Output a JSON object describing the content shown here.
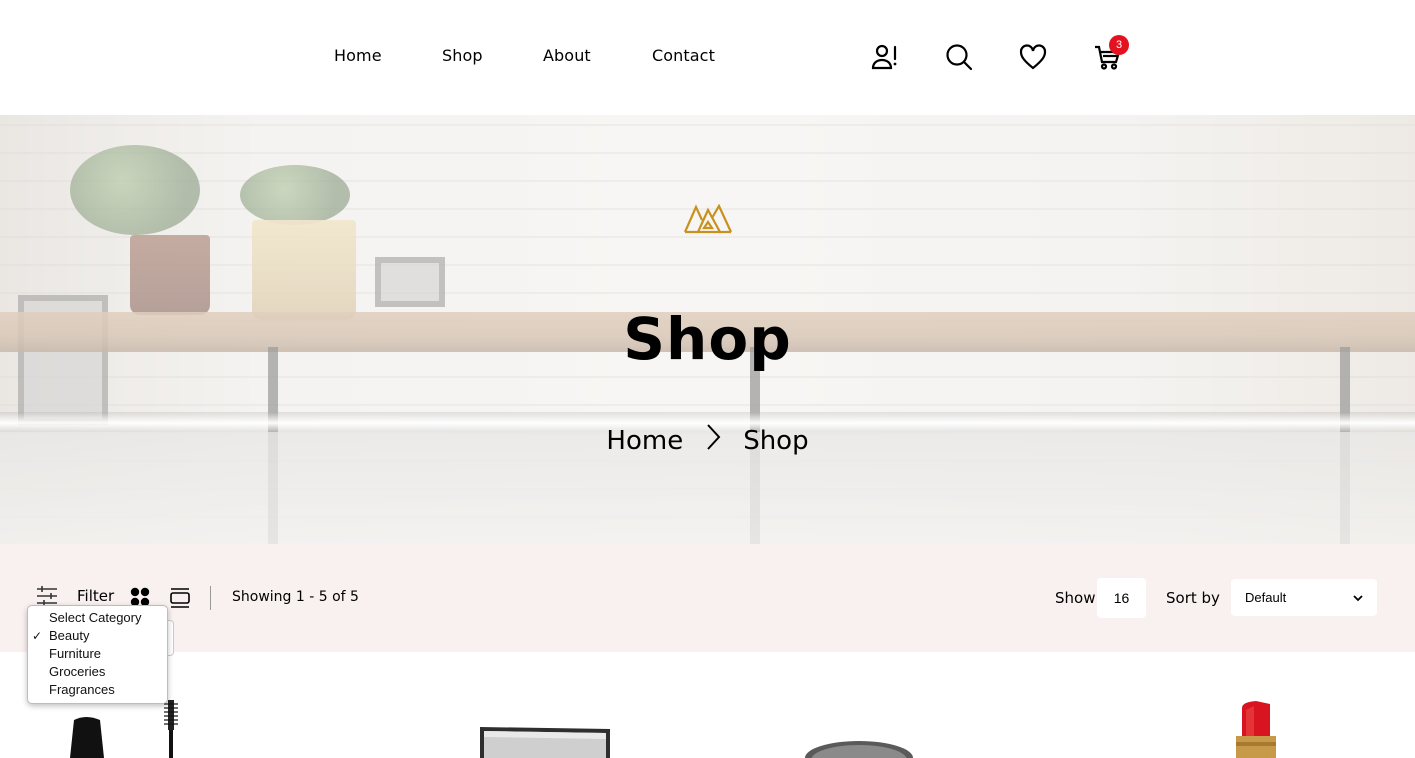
{
  "nav": {
    "items": [
      "Home",
      "Shop",
      "About",
      "Contact"
    ]
  },
  "header_icons": {
    "user": "user-alert-icon",
    "search": "search-icon",
    "wishlist": "heart-icon",
    "cart": "cart-icon",
    "cart_count": "3",
    "badge_color": "#e4121f"
  },
  "hero": {
    "title": "Shop",
    "breadcrumb": [
      "Home",
      "Shop"
    ],
    "logo_color": "#c8911e"
  },
  "toolbar": {
    "filter_label": "Filter",
    "showing_text": "Showing 1 - 5 of 5",
    "show_label": "Show",
    "show_value": "16",
    "sort_label": "Sort by",
    "sort_value": "Default",
    "background": "#f9f1f0"
  },
  "category_dropdown": {
    "options": [
      "Select Category",
      "Beauty",
      "Furniture",
      "Groceries",
      "Fragrances"
    ],
    "selected": "Beauty"
  }
}
